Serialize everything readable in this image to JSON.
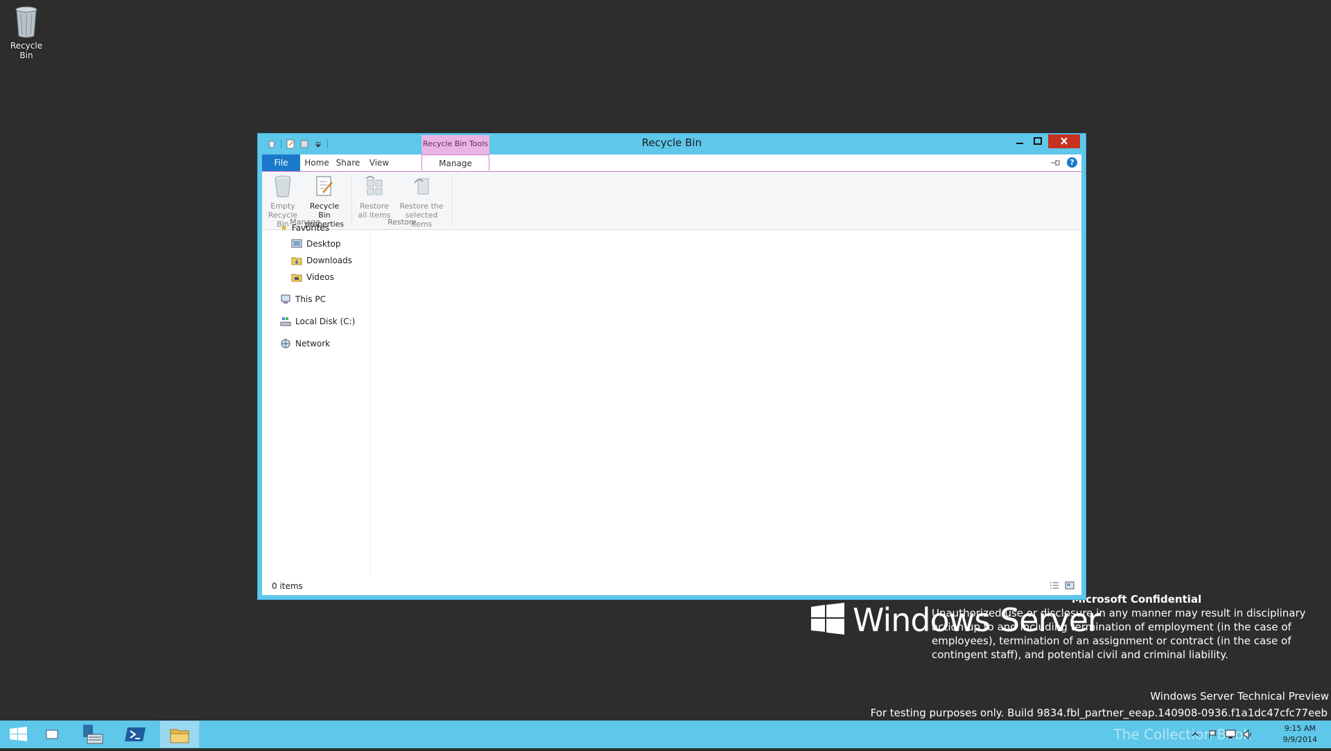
{
  "desktop": {
    "icons": [
      {
        "label": "Recycle Bin",
        "icon": "recycle-bin-icon"
      }
    ]
  },
  "window": {
    "title": "Recycle Bin",
    "context_tab_label": "Recycle Bin Tools",
    "tabs": {
      "file": "File",
      "home": "Home",
      "share": "Share",
      "view": "View",
      "manage": "Manage"
    },
    "ribbon": {
      "empty_bin": "Empty Recycle Bin",
      "bin_properties": "Recycle Bin properties",
      "restore_all": "Restore all items",
      "restore_selected": "Restore the selected items",
      "group_manage": "Manage",
      "group_restore": "Restore"
    },
    "nav": {
      "favorites": "Favorites",
      "desktop": "Desktop",
      "downloads": "Downloads",
      "videos": "Videos",
      "this_pc": "This PC",
      "local_disk": "Local Disk (C:)",
      "network": "Network"
    },
    "status": {
      "item_count": "0 items"
    }
  },
  "watermark": {
    "brand": "Windows Server",
    "confidential_title": "Microsoft Confidential",
    "confidential_text": "Unauthorized use or disclosure in any manner may result in disciplinary action up to and including termination of employment (in the case of employees), termination of an assignment or contract (in the case of contingent staff), and potential civil and criminal liability.",
    "technical_preview": "Windows Server Technical Preview",
    "build_text": "For testing purposes only. Build 9834.fbl_partner_eeap.140908-0936.f1a1dc47cfc77eeb"
  },
  "taskbar": {
    "clock_time": "9:15 AM",
    "clock_date": "9/9/2014",
    "collection_overlay": "The Collection Book"
  },
  "colors": {
    "desktop_bg": "#2d2d2d",
    "accent": "#5ec7ea",
    "file_tab": "#1979ca",
    "context_tab": "#e7b6e4",
    "close_button": "#c7311f"
  }
}
